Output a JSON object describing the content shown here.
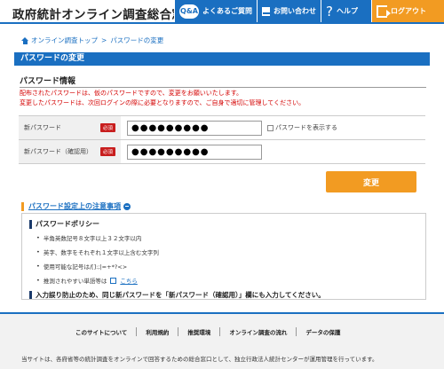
{
  "header": {
    "site_title": "政府統計オンライン調査総合窓口",
    "nav": {
      "faq_icon": "Q&A",
      "faq": "よくあるご質問",
      "contact": "お問い合わせ",
      "help": "ヘルプ",
      "logout": "ログアウト"
    },
    "colors": {
      "primary": "#1a6fc1",
      "logout": "#f29b22"
    }
  },
  "breadcrumb": {
    "home": "オンライン調査トップ",
    "separator": ">",
    "current": "パスワードの変更"
  },
  "page_title": "パスワードの変更",
  "section": {
    "heading": "パスワード情報",
    "notice_line1": "配布されたパスワードは、仮のパスワードですので、変更をお願いいたします。",
    "notice_line2": "変更したパスワードは、次回ログインの際に必要となりますので、ご自身で適切に管理してください。"
  },
  "form": {
    "new_password": {
      "label": "新パスワード",
      "required": "必須",
      "value": "●●●●●●●●●"
    },
    "confirm_password": {
      "label": "新パスワード（確認用）",
      "required": "必須",
      "value": "●●●●●●●●●"
    },
    "show_password_label": "パスワードを表示する",
    "submit_label": "変更"
  },
  "notes": {
    "link_label": "パスワード設定上の注意事項",
    "policy_title": "パスワードポリシー",
    "items": [
      "半角英数記号８文字以上３２文字以内",
      "英字、数字をそれぞれ１文字以上含む文字列",
      "使用可能な記号は/[]:;|=+*?<>"
    ],
    "hint_prefix": "推測されやすい単語等は",
    "hint_link": "こちら",
    "warning": "入力誤り防止のため、同じ新パスワードを「新パスワード（確認用）」欄にも入力してください。"
  },
  "footer": {
    "links": [
      "このサイトについて",
      "利用規約",
      "推奨環境",
      "オンライン調査の流れ",
      "データの保護"
    ],
    "text": "当サイトは、各府省等の統計調査をオンラインで回答するための総合窓口として、独立行政法人統計センターが運用管理を行っています。"
  }
}
